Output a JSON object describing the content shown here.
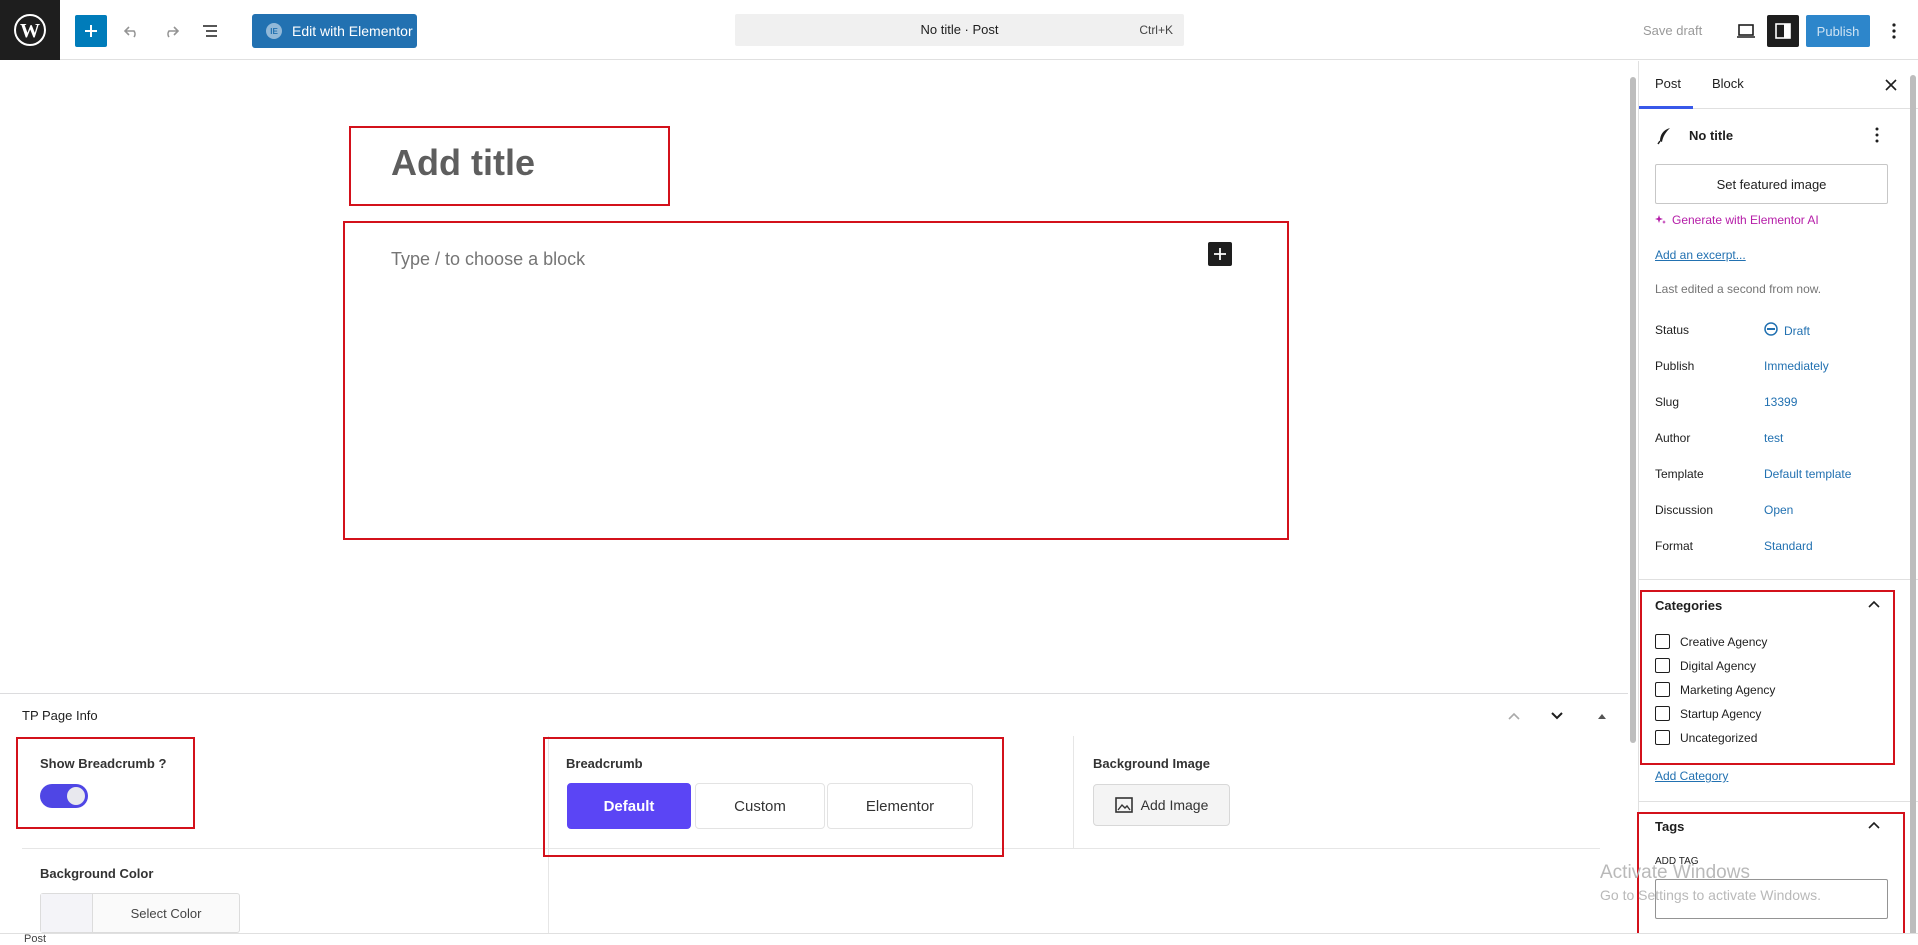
{
  "toolbar": {
    "elementor_label": "Edit with Elementor",
    "command_title": "No title · Post",
    "command_shortcut": "Ctrl+K",
    "save_draft_label": "Save draft",
    "publish_label": "Publish"
  },
  "canvas": {
    "title_placeholder": "Add title",
    "block_placeholder": "Type / to choose a block"
  },
  "metabox": {
    "title": "TP Page Info",
    "show_breadcrumb_label": "Show Breadcrumb ?",
    "show_breadcrumb_on": true,
    "breadcrumb_label": "Breadcrumb",
    "breadcrumb_options": [
      "Default",
      "Custom",
      "Elementor"
    ],
    "breadcrumb_selected": "Default",
    "background_image_label": "Background Image",
    "add_image_label": "Add Image",
    "background_color_label": "Background Color",
    "select_color_label": "Select Color"
  },
  "sidebar": {
    "tabs": [
      "Post",
      "Block"
    ],
    "active_tab": "Post",
    "post_title": "No title",
    "featured_image_label": "Set featured image",
    "generate_ai_label": "Generate with Elementor AI",
    "excerpt_link": "Add an excerpt...",
    "last_edited": "Last edited a second from now.",
    "meta": [
      {
        "label": "Status",
        "value": "Draft"
      },
      {
        "label": "Publish",
        "value": "Immediately"
      },
      {
        "label": "Slug",
        "value": "13399"
      },
      {
        "label": "Author",
        "value": "test"
      },
      {
        "label": "Template",
        "value": "Default template"
      },
      {
        "label": "Discussion",
        "value": "Open"
      },
      {
        "label": "Format",
        "value": "Standard"
      }
    ],
    "categories_title": "Categories",
    "categories": [
      "Creative Agency",
      "Digital Agency",
      "Marketing Agency",
      "Startup Agency",
      "Uncategorized"
    ],
    "add_category_link": "Add Category",
    "tags_title": "Tags",
    "add_tag_label": "ADD TAG"
  },
  "footer": {
    "breadcrumb": "Post"
  },
  "watermark": {
    "line1": "Activate Windows",
    "line2": "Go to Settings to activate Windows."
  },
  "colors": {
    "accent": "#007cba",
    "highlight": "#d3111b",
    "toggle": "#4f46e5",
    "segment_active": "#5b45f5",
    "ai_magenta": "#b51da8"
  }
}
